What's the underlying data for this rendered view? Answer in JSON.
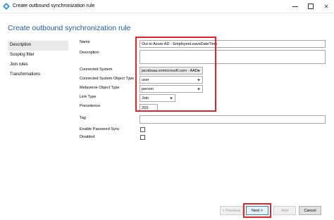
{
  "window": {
    "title": "Create outbound synchronization rule",
    "controls": {
      "close_glyph": "✕"
    }
  },
  "page_title": "Create outbound synchronization rule",
  "nav": {
    "items": [
      {
        "label": "Description",
        "active": true
      },
      {
        "label": "Scoping filter"
      },
      {
        "label": "Join rules"
      },
      {
        "label": "Transformations"
      }
    ]
  },
  "form": {
    "name_label": "Name",
    "name_value": "Out to Azure AD - EmployeeLeaveDateTime",
    "description_label": "Description",
    "description_value": "",
    "connected_system_label": "Connected System",
    "connected_system_value": "jacobsaa.onmicrosoft.com - AAD",
    "connected_system_object_type_label": "Connected System Object Type",
    "connected_system_object_type_value": "user",
    "metaverse_object_type_label": "Metaverse Object Type",
    "metaverse_object_type_value": "person",
    "link_type_label": "Link Type",
    "link_type_value": "Join",
    "precedence_label": "Precedence",
    "precedence_value": "203",
    "tag_label": "Tag",
    "tag_value": "",
    "enable_password_sync_label": "Enable Password Sync",
    "disabled_label": "Disabled"
  },
  "footer": {
    "previous_label": "< Previous",
    "next_label": "Next >",
    "add_label": "Add",
    "cancel_label": "Cancel"
  },
  "colors": {
    "accent_title": "#1e5aa8",
    "highlight_red": "#e0262b",
    "app_icon": "#2e8fd8"
  },
  "icons": {
    "app": "azure-ad-connect-icon",
    "minimize": "minimize-icon",
    "maximize": "maximize-icon",
    "close": "close-icon",
    "dropdown": "chevron-down-icon"
  }
}
